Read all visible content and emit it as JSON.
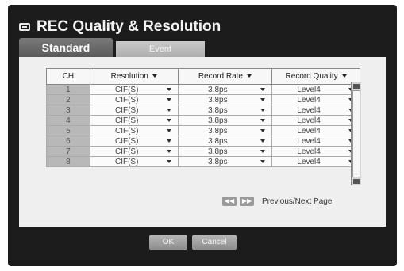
{
  "window": {
    "title": "REC Quality & Resolution"
  },
  "tabs": [
    {
      "label": "Standard",
      "active": true
    },
    {
      "label": "Event",
      "active": false
    }
  ],
  "table": {
    "headers": {
      "ch": "CH",
      "resolution": "Resolution",
      "rate": "Record Rate",
      "quality": "Record Quality"
    },
    "rows": [
      {
        "ch": "1",
        "resolution": "CIF(S)",
        "rate": "3.8ps",
        "quality": "Level4"
      },
      {
        "ch": "2",
        "resolution": "CIF(S)",
        "rate": "3.8ps",
        "quality": "Level4"
      },
      {
        "ch": "3",
        "resolution": "CIF(S)",
        "rate": "3.8ps",
        "quality": "Level4"
      },
      {
        "ch": "4",
        "resolution": "CIF(S)",
        "rate": "3.8ps",
        "quality": "Level4"
      },
      {
        "ch": "5",
        "resolution": "CIF(S)",
        "rate": "3.8ps",
        "quality": "Level4"
      },
      {
        "ch": "6",
        "resolution": "CIF(S)",
        "rate": "3.8ps",
        "quality": "Level4"
      },
      {
        "ch": "7",
        "resolution": "CIF(S)",
        "rate": "3.8ps",
        "quality": "Level4"
      },
      {
        "ch": "8",
        "resolution": "CIF(S)",
        "rate": "3.8ps",
        "quality": "Level4"
      }
    ]
  },
  "pager": {
    "prev_glyph": "◀◀",
    "next_glyph": "▶▶",
    "label": "Previous/Next Page"
  },
  "buttons": {
    "ok": "OK",
    "cancel": "Cancel"
  },
  "colors": {
    "frame": "#1c1c1c",
    "panel": "#efefef",
    "tab_active": "#6a6a6a",
    "tab_inactive": "#bdbdbd"
  }
}
